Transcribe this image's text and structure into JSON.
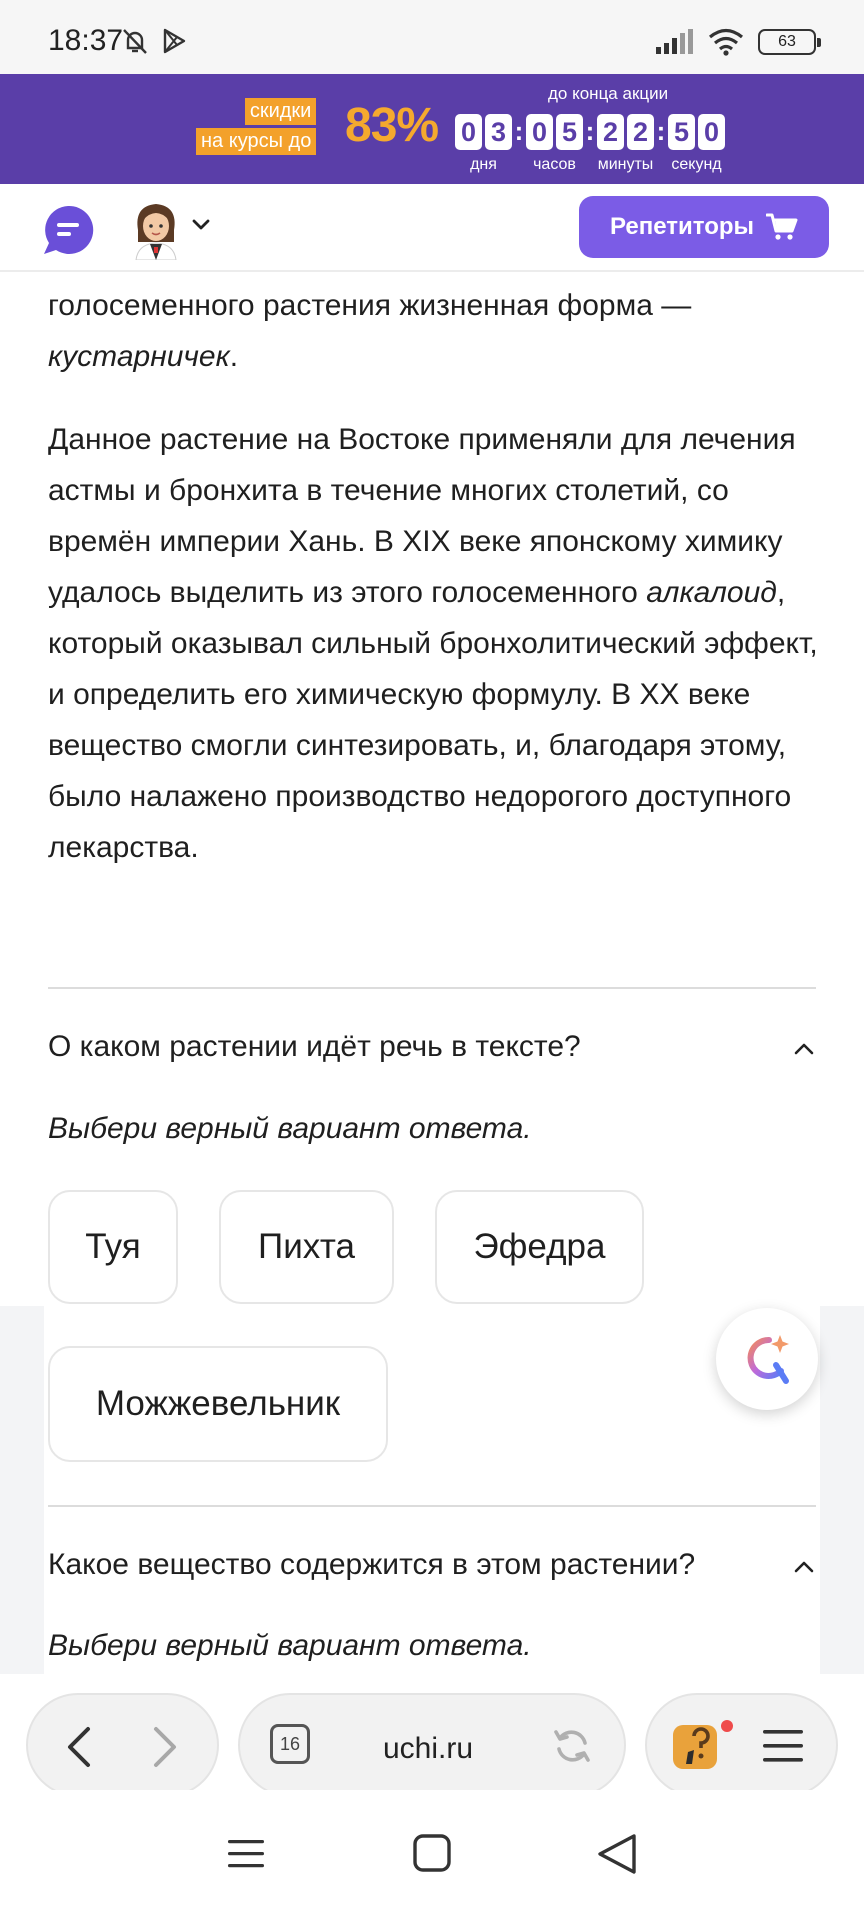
{
  "status_bar": {
    "time": "18:37",
    "battery": "63"
  },
  "promo": {
    "label_line1": "скидки",
    "label_line2": "на курсы до",
    "percent": "83%",
    "until": "до конца акции",
    "timer": {
      "days": [
        "0",
        "3"
      ],
      "hours": [
        "0",
        "5"
      ],
      "minutes": [
        "2",
        "2"
      ],
      "seconds": [
        "5",
        "0"
      ],
      "days_label": "дня",
      "hours_label": "часов",
      "minutes_label": "минуты",
      "seconds_label": "секунд"
    },
    "colors": {
      "background": "#5a3ea8",
      "accent": "#f5a92e"
    }
  },
  "header": {
    "tutors_button": "Репетиторы",
    "accent_color": "#7b5ce6"
  },
  "article": {
    "p1_line1": "голосеменного растения жизненная форма —",
    "p1_line2_em": "кустарничек",
    "p1_line2_tail": ".",
    "p2_a": "Данное растение на Востоке применяли для лечения астмы и бронхита в течение многих столетий, со времён империи Хань. В XIX веке японскому химику удалось выделить из этого голосеменного ",
    "p2_em": "алкалоид",
    "p2_b": ", который оказывал сильный бронхолитический эффект, и определить его химическую формулу. В XX веке вещество смогли синтезировать, и, благодаря этому, было налажено производство недорогого доступного лекарства."
  },
  "questions": [
    {
      "text": "О каком растении идёт речь в тексте?",
      "hint": "Выбери верный вариант ответа.",
      "options": [
        "Туя",
        "Пихта",
        "Эфедра",
        "Можжевельник"
      ]
    },
    {
      "text": "Какое вещество содержится в этом растении?",
      "hint": "Выбери верный вариант ответа."
    }
  ],
  "browser": {
    "url": "uchi.ru",
    "tab_count": "16"
  },
  "icons": {
    "chat": "chat-bubble-icon",
    "avatar": "avatar",
    "cart": "cart-icon",
    "assistant": "assistant-icon",
    "back": "back-arrow-icon",
    "forward": "forward-arrow-icon",
    "reload": "reload-icon",
    "menu": "hamburger-menu-icon"
  }
}
